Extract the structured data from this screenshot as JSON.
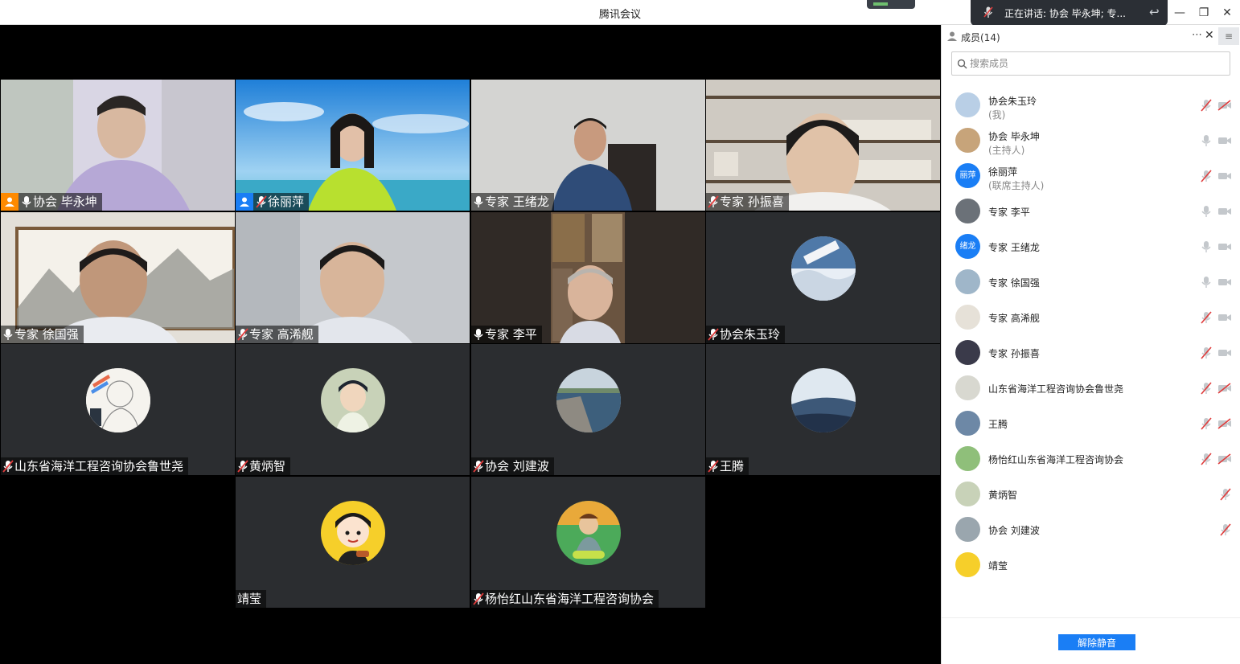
{
  "window": {
    "title": "腾讯会议"
  },
  "speaking": {
    "text": "正在讲话: 协会 毕永坤; 专..."
  },
  "tiles": [
    {
      "name": "协会 毕永坤",
      "mic": "on",
      "host": true
    },
    {
      "name": "徐丽萍",
      "mic": "off",
      "host": true
    },
    {
      "name": "专家 王绪龙",
      "mic": "on",
      "host": false
    },
    {
      "name": "专家 孙振喜",
      "mic": "off",
      "host": false
    },
    {
      "name": "专家 徐国强",
      "mic": "on",
      "host": false
    },
    {
      "name": "专家 高浠舰",
      "mic": "off",
      "host": false
    },
    {
      "name": "专家 李平",
      "mic": "on",
      "host": false
    },
    {
      "name": "协会朱玉玲",
      "mic": "off",
      "host": false
    },
    {
      "name": "山东省海洋工程咨询协会鲁世尧",
      "mic": "off",
      "host": false
    },
    {
      "name": "黄炳智",
      "mic": "off",
      "host": false
    },
    {
      "name": "协会  刘建波",
      "mic": "off",
      "host": false
    },
    {
      "name": "王腾",
      "mic": "off",
      "host": false
    },
    {
      "name": "靖莹",
      "mic": "none",
      "host": false
    },
    {
      "name": "杨怡红山东省海洋工程咨询协会",
      "mic": "off",
      "host": false
    }
  ],
  "panel": {
    "members_label": "成员(14)",
    "search_placeholder": "搜索成员",
    "unmute_label": "解除静音",
    "members": [
      {
        "name": "协会朱玉玲",
        "role": "(我)",
        "mic": "off",
        "cam": "off"
      },
      {
        "name": "协会 毕永坤",
        "role": "(主持人)",
        "mic": "on",
        "cam": "on"
      },
      {
        "name": "徐丽萍",
        "role": "(联席主持人)",
        "mic": "off",
        "cam": "on",
        "avatar_text": "丽萍"
      },
      {
        "name": "专家 李平",
        "role": "",
        "mic": "on",
        "cam": "on"
      },
      {
        "name": "专家 王绪龙",
        "role": "",
        "mic": "on",
        "cam": "on",
        "avatar_text": "绪龙"
      },
      {
        "name": "专家 徐国强",
        "role": "",
        "mic": "on",
        "cam": "on"
      },
      {
        "name": "专家 高浠舰",
        "role": "",
        "mic": "off",
        "cam": "on"
      },
      {
        "name": "专家 孙振喜",
        "role": "",
        "mic": "off",
        "cam": "on"
      },
      {
        "name": "山东省海洋工程咨询协会鲁世尧",
        "role": "",
        "mic": "off",
        "cam": "off"
      },
      {
        "name": "王腾",
        "role": "",
        "mic": "off",
        "cam": "off"
      },
      {
        "name": "杨怡红山东省海洋工程咨询协会",
        "role": "",
        "mic": "off",
        "cam": "off"
      },
      {
        "name": "黄炳智",
        "role": "",
        "mic": "off",
        "cam": "none"
      },
      {
        "name": "协会  刘建波",
        "role": "",
        "mic": "off",
        "cam": "none"
      },
      {
        "name": "靖莹",
        "role": "",
        "mic": "none",
        "cam": "none"
      }
    ]
  },
  "colors": {
    "accent": "#1a7ef5",
    "active_border": "#2fb34a",
    "host_badge": "#ff8a00",
    "cohost_badge": "#1a7ef5",
    "muted_red": "#e03c3c"
  }
}
